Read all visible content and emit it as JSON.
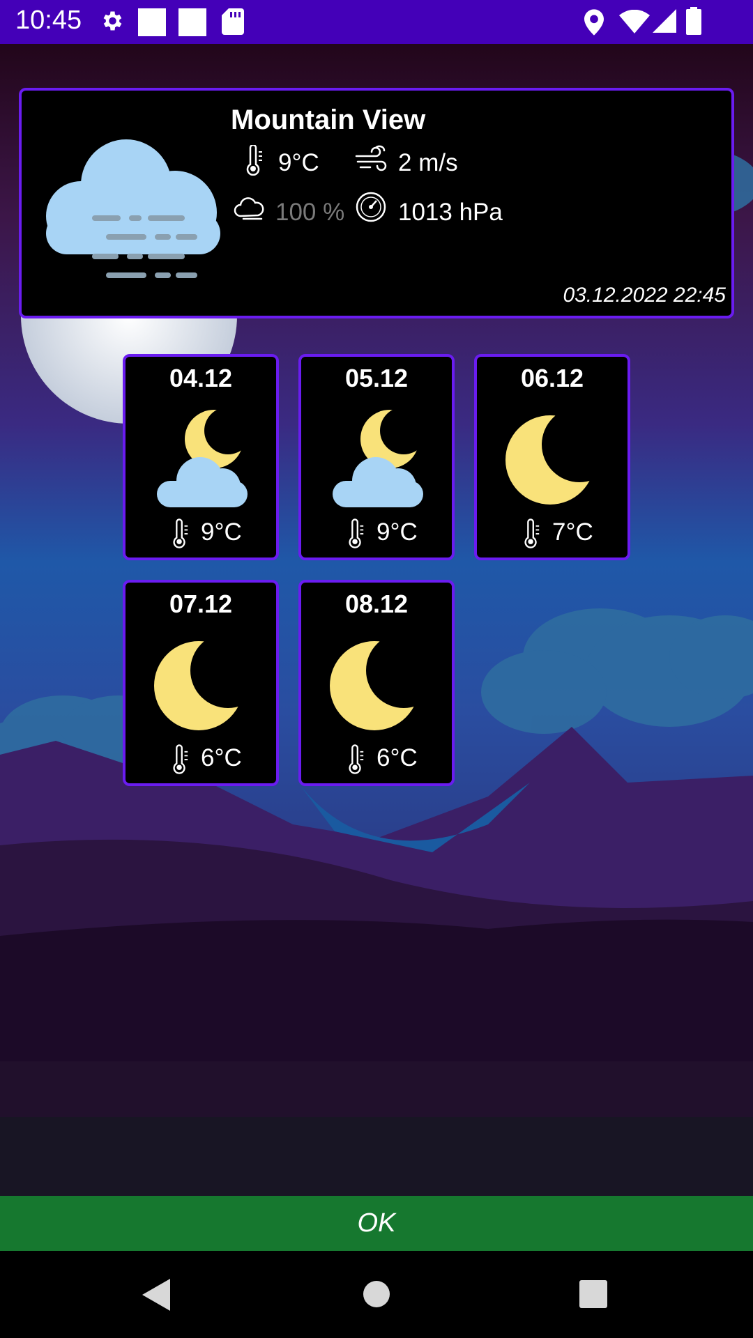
{
  "status_bar": {
    "time": "10:45",
    "icons": [
      "gear-icon",
      "square-icon",
      "square-icon",
      "sd-card-icon",
      "location-icon",
      "wifi-icon",
      "signal-icon",
      "battery-icon"
    ],
    "color": "#4400b8"
  },
  "current": {
    "city": "Mountain View",
    "condition_icon": "fog-cloud-icon",
    "temperature": "9°C",
    "wind": "2 m/s",
    "cloudiness": "100 %",
    "pressure": "1013 hPa",
    "updated": "03.12.2022 22:45"
  },
  "forecast": [
    {
      "date": "04.12",
      "icon": "moon-cloud-icon",
      "temp": "9°C"
    },
    {
      "date": "05.12",
      "icon": "moon-cloud-icon",
      "temp": "9°C"
    },
    {
      "date": "06.12",
      "icon": "moon-icon",
      "temp": "7°C"
    },
    {
      "date": "07.12",
      "icon": "moon-icon",
      "temp": "6°C"
    },
    {
      "date": "08.12",
      "icon": "moon-icon",
      "temp": "6°C"
    }
  ],
  "ok_button": {
    "label": "OK",
    "color": "#16782f"
  },
  "nav": {
    "icons": [
      "back-icon",
      "home-icon",
      "recents-icon"
    ]
  },
  "colors": {
    "card_border": "#6a1cf0",
    "moon": "#f9e27a",
    "cloud": "#a8d4f5"
  }
}
